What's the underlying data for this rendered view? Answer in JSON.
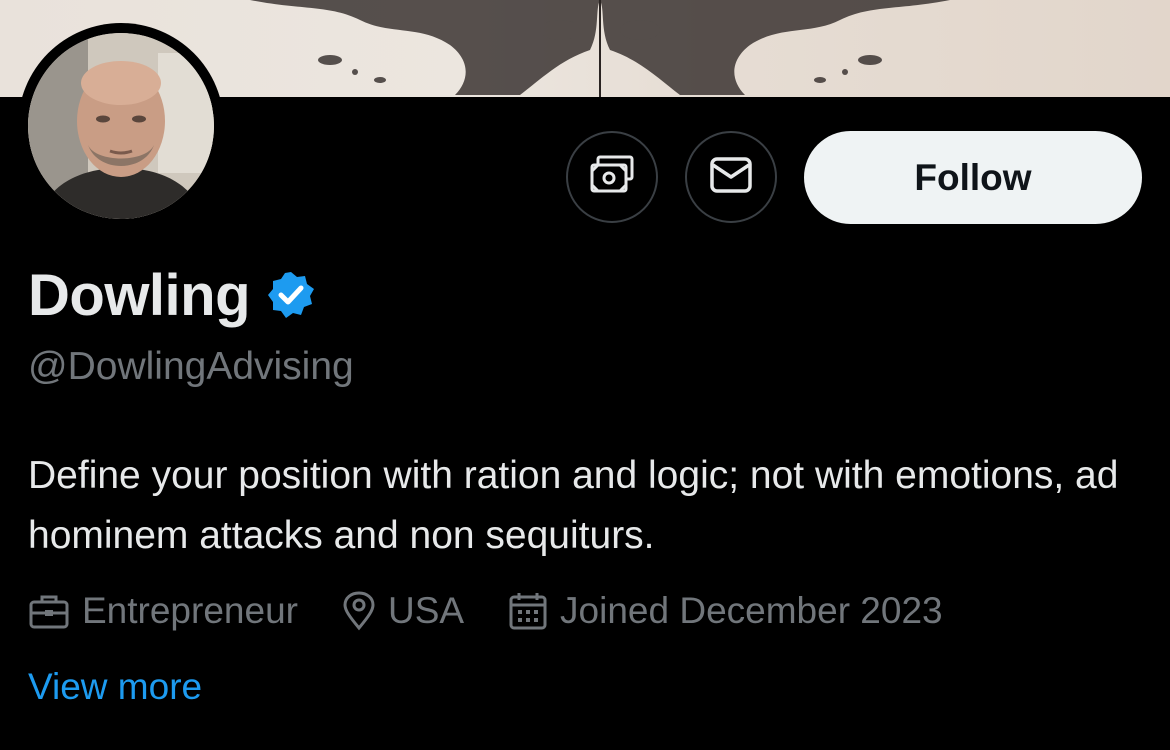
{
  "profile": {
    "name": "Dowling",
    "handle": "@DowlingAdvising",
    "bio": "Define your position with ration and logic; not with emotions, ad hominem attacks and non sequiturs.",
    "verified": true
  },
  "actions": {
    "follow_label": "Follow",
    "tip_icon": "money-icon",
    "message_icon": "envelope-icon"
  },
  "meta": {
    "profession": "Entrepreneur",
    "location": "USA",
    "joined": "Joined December 2023"
  },
  "links": {
    "view_more": "View more"
  },
  "colors": {
    "background": "#000000",
    "text_primary": "#e7e9ea",
    "text_secondary": "#71767b",
    "accent": "#1d9bf0",
    "follow_bg": "#eff3f4"
  }
}
